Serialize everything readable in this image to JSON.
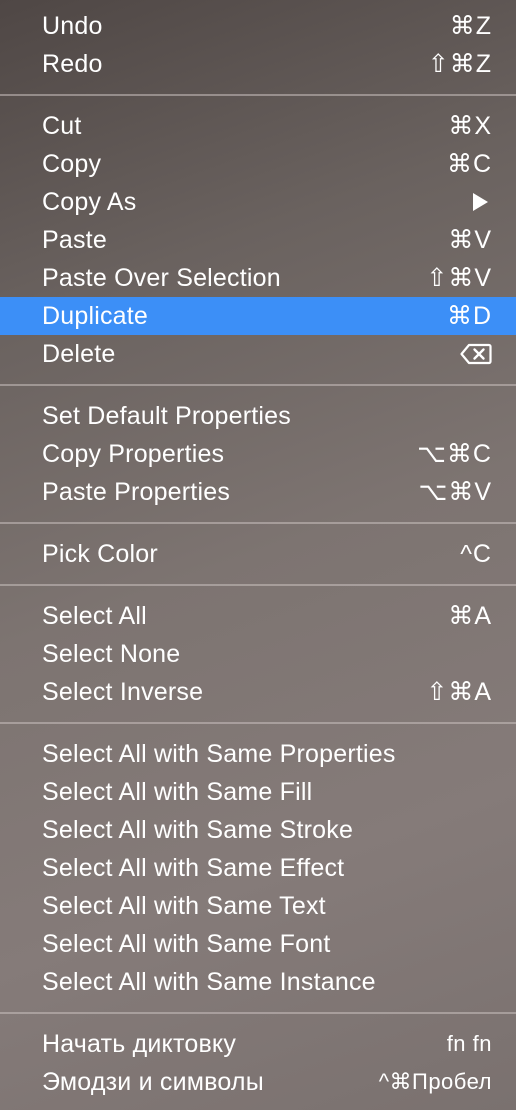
{
  "menu": {
    "groups": [
      {
        "items": [
          {
            "label": "Undo",
            "shortcut": "⌘Z"
          },
          {
            "label": "Redo",
            "shortcut": "⇧⌘Z"
          }
        ]
      },
      {
        "items": [
          {
            "label": "Cut",
            "shortcut": "⌘X"
          },
          {
            "label": "Copy",
            "shortcut": "⌘C"
          },
          {
            "label": "Copy As",
            "shortcut_icon": "submenu-arrow-icon"
          },
          {
            "label": "Paste",
            "shortcut": "⌘V"
          },
          {
            "label": "Paste Over Selection",
            "shortcut": "⇧⌘V"
          },
          {
            "label": "Duplicate",
            "shortcut": "⌘D",
            "highlighted": true
          },
          {
            "label": "Delete",
            "shortcut_icon": "delete-key-icon"
          }
        ]
      },
      {
        "items": [
          {
            "label": "Set Default Properties",
            "shortcut": ""
          },
          {
            "label": "Copy Properties",
            "shortcut": "⌥⌘C"
          },
          {
            "label": "Paste Properties",
            "shortcut": "⌥⌘V"
          }
        ]
      },
      {
        "items": [
          {
            "label": "Pick Color",
            "shortcut": "^C"
          }
        ]
      },
      {
        "items": [
          {
            "label": "Select All",
            "shortcut": "⌘A"
          },
          {
            "label": "Select None",
            "shortcut": ""
          },
          {
            "label": "Select Inverse",
            "shortcut": "⇧⌘A"
          }
        ]
      },
      {
        "items": [
          {
            "label": "Select All with Same Properties",
            "shortcut": ""
          },
          {
            "label": "Select All with Same Fill",
            "shortcut": ""
          },
          {
            "label": "Select All with Same Stroke",
            "shortcut": ""
          },
          {
            "label": "Select All with Same Effect",
            "shortcut": ""
          },
          {
            "label": "Select All with Same Text",
            "shortcut": ""
          },
          {
            "label": "Select All with Same Font",
            "shortcut": ""
          },
          {
            "label": "Select All with Same Instance",
            "shortcut": ""
          }
        ]
      },
      {
        "items": [
          {
            "label": "Начать диктовку",
            "shortcut": "fn fn"
          },
          {
            "label": "Эмодзи и символы",
            "shortcut": "^⌘Пробел"
          }
        ]
      }
    ],
    "colors": {
      "highlight": "#3c8ff7",
      "text": "#ffffff",
      "separator": "#c8c0be"
    }
  }
}
